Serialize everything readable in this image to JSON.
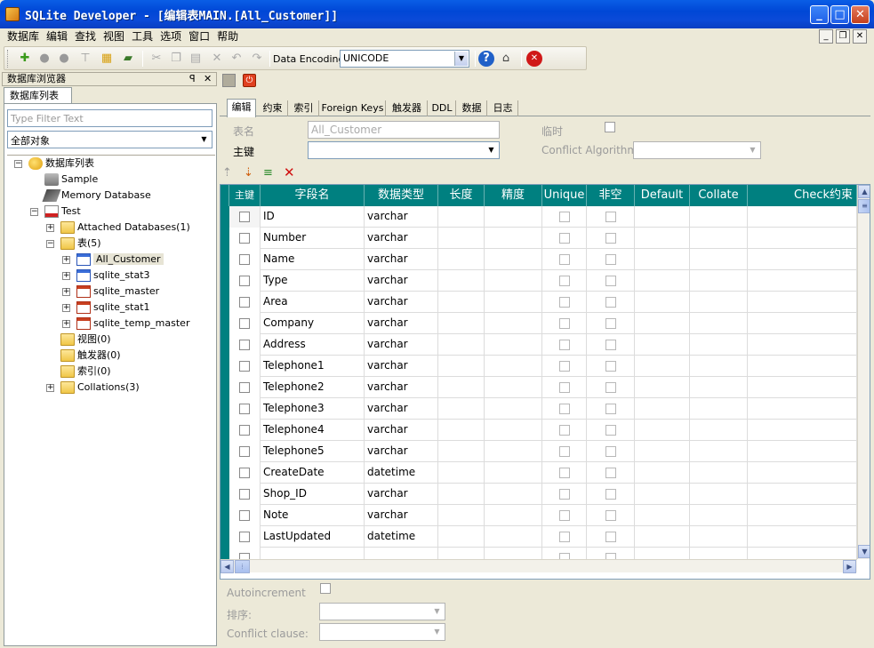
{
  "window": {
    "title": "SQLite Developer - [编辑表MAIN.[All_Customer]]",
    "min": "_",
    "max": "□",
    "close": "✕"
  },
  "menu": [
    "数据库",
    "编辑",
    "查找",
    "视图",
    "工具",
    "选项",
    "窗口",
    "帮助"
  ],
  "mdi": {
    "min": "_",
    "restore": "❐",
    "close": "✕"
  },
  "toolbar": {
    "encoding_label": "Data Encoding:",
    "encoding_value": "UNICODE"
  },
  "browser": {
    "header": "数据库浏览器",
    "pin": "ᵖ",
    "close": "✕",
    "tab": "数据库列表",
    "filter_placeholder": "Type Filter Text",
    "object_filter": "全部对象",
    "tree": {
      "root": "数据库列表",
      "sample": "Sample",
      "memory": "Memory Database",
      "test": "Test",
      "attached": "Attached Databases(1)",
      "tables": "表(5)",
      "table_items": [
        "All_Customer",
        "sqlite_stat3",
        "sqlite_master",
        "sqlite_stat1",
        "sqlite_temp_master"
      ],
      "views": "视图(0)",
      "triggers": "触发器(0)",
      "indexes": "索引(0)",
      "collations": "Collations(3)"
    }
  },
  "editor": {
    "tabs": [
      "编辑",
      "约束",
      "索引",
      "Foreign Keys",
      "触发器",
      "DDL",
      "数据",
      "日志"
    ],
    "table_name_label": "表名",
    "table_name_value": "All_Customer",
    "temp_label": "临时",
    "pk_label": "主键",
    "conflict_label": "Conflict Algorithm",
    "columns": [
      "主键",
      "字段名",
      "数据类型",
      "长度",
      "精度",
      "Unique",
      "非空",
      "Default",
      "Collate",
      "Check约束"
    ],
    "rows": [
      {
        "name": "ID",
        "type": "varchar"
      },
      {
        "name": "Number",
        "type": "varchar"
      },
      {
        "name": "Name",
        "type": "varchar"
      },
      {
        "name": "Type",
        "type": "varchar"
      },
      {
        "name": "Area",
        "type": "varchar"
      },
      {
        "name": "Company",
        "type": "varchar"
      },
      {
        "name": "Address",
        "type": "varchar"
      },
      {
        "name": "Telephone1",
        "type": "varchar"
      },
      {
        "name": "Telephone2",
        "type": "varchar"
      },
      {
        "name": "Telephone3",
        "type": "varchar"
      },
      {
        "name": "Telephone4",
        "type": "varchar"
      },
      {
        "name": "Telephone5",
        "type": "varchar"
      },
      {
        "name": "CreateDate",
        "type": "datetime"
      },
      {
        "name": "Shop_ID",
        "type": "varchar"
      },
      {
        "name": "Note",
        "type": "varchar"
      },
      {
        "name": "LastUpdated",
        "type": "datetime"
      },
      {
        "name": "",
        "type": ""
      }
    ],
    "autoincrement_label": "Autoincrement",
    "sort_label": "排序:",
    "conflict_clause_label": "Conflict clause:"
  }
}
